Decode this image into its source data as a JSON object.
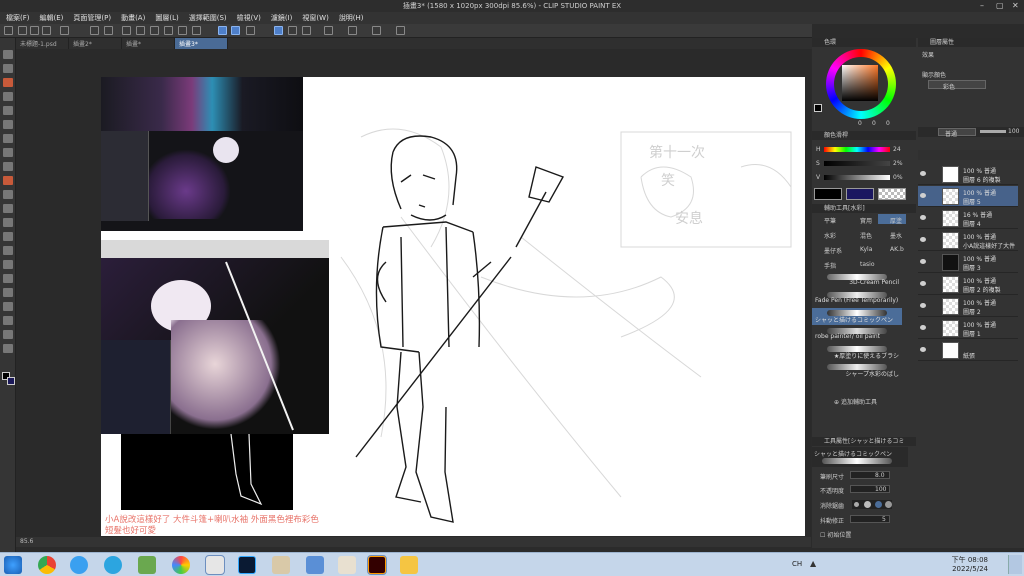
{
  "window": {
    "title": "插畫3* (1580 x 1020px 300dpi 85.6%) - CLIP STUDIO PAINT EX"
  },
  "menu": [
    "檔案(F)",
    "編輯(E)",
    "頁面管理(P)",
    "動畫(A)",
    "圖層(L)",
    "選擇範圍(S)",
    "檢視(V)",
    "濾鏡(I)",
    "視窗(W)",
    "說明(H)"
  ],
  "tabs": [
    {
      "label": "未標題-1.psd",
      "active": false
    },
    {
      "label": "插畫2*",
      "active": false
    },
    {
      "label": "插畫*",
      "active": false
    },
    {
      "label": "插畫3*",
      "active": true
    }
  ],
  "canvas": {
    "note_line1": "小A說改這樣好了 大件斗篷+喇叭水袖 外面黑色裡布彩色",
    "note_line2": "短髮也好可愛",
    "sketch_text": [
      "第十一次",
      "笑",
      "安息"
    ],
    "zoom": "85.6"
  },
  "color_panel": {
    "title": "色環",
    "sliders": [
      {
        "label": "H",
        "value": "24"
      },
      {
        "label": "S",
        "value": "2%"
      },
      {
        "label": "V",
        "value": "0%"
      }
    ],
    "readout": [
      "0",
      "0",
      "0"
    ]
  },
  "color_set_panel": {
    "title": "顏色滑桿"
  },
  "sub_tool_panel": {
    "title": "輔助工具[水彩]",
    "tools": [
      "平筆",
      "實用",
      "厚塗",
      "水彩",
      "混色",
      "墨水",
      "墨仔系",
      "Kyla",
      "AK.b",
      "手指",
      "tasio"
    ],
    "brushes": [
      "3D-Cream Pencil",
      "Fade Pen (Free Temporarily)",
      "シャッと描けるコミックペン",
      "robe painter/ oil paint",
      "★厚塗りに使えるブラシ",
      "シャープ水彩のばし"
    ],
    "selected_brush": "シャッと描けるコミックペン",
    "add_button": "追加輔助工具"
  },
  "tool_property": {
    "title": "工具屬性[シャッと描けるコミ",
    "brush_name": "シャッと描けるコミックペン",
    "rows": [
      {
        "label": "筆刷尺寸",
        "value": "8.0"
      },
      {
        "label": "不透明度",
        "value": "100"
      },
      {
        "label": "消除鋸齒",
        "value": ""
      },
      {
        "label": "抖動修正",
        "value": "5"
      }
    ],
    "checkbox": "初始位置"
  },
  "layer_property": {
    "title": "圖層屬性",
    "effect_label": "效果",
    "display_color_label": "顯示顏色",
    "display_color_value": "彩色"
  },
  "layer_panel": {
    "blend_mode": "普通",
    "opacity": "100",
    "layers": [
      {
        "line1": "100 % 普通",
        "line2": "圖層 6 的複製",
        "selected": false
      },
      {
        "line1": "100 % 普通",
        "line2": "圖層 5",
        "selected": true
      },
      {
        "line1": "16 % 普通",
        "line2": "圖層 4",
        "selected": false
      },
      {
        "line1": "100 % 普通",
        "line2": "小A說這樣好了大件",
        "selected": false
      },
      {
        "line1": "100 % 普通",
        "line2": "圖層 3",
        "selected": false
      },
      {
        "line1": "100 % 普通",
        "line2": "圖層 2 的複製",
        "selected": false
      },
      {
        "line1": "100 % 普通",
        "line2": "圖層 2",
        "selected": false
      },
      {
        "line1": "100 % 普通",
        "line2": "圖層 1",
        "selected": false
      },
      {
        "line1": "",
        "line2": "紙張",
        "selected": false
      }
    ]
  },
  "taskbar": {
    "time_label": "下午 08:08",
    "date_label": "2022/5/24",
    "lang": "CH"
  }
}
